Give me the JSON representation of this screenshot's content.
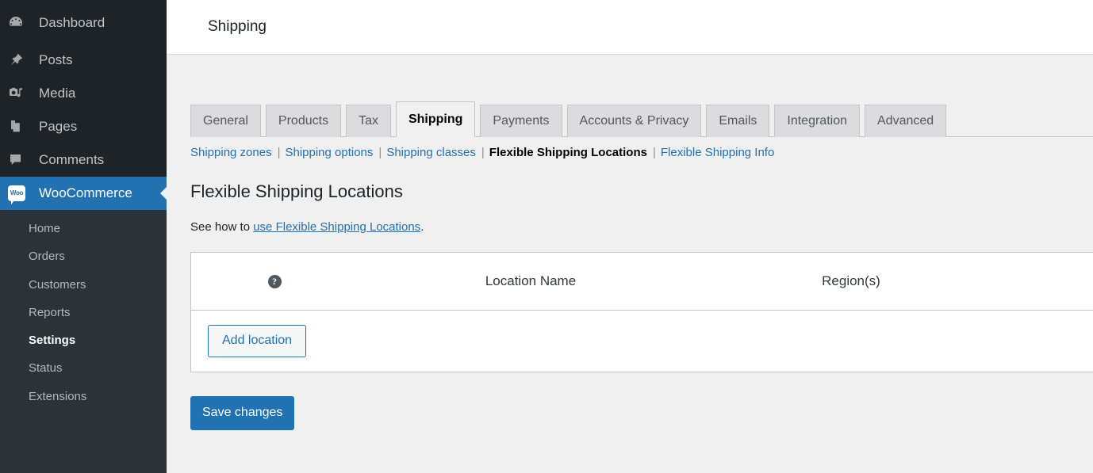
{
  "header": {
    "title": "Shipping"
  },
  "sidebar": {
    "items": [
      {
        "label": "Dashboard",
        "icon": "dashboard-icon"
      },
      {
        "label": "Posts",
        "icon": "pin-icon"
      },
      {
        "label": "Media",
        "icon": "media-icon"
      },
      {
        "label": "Pages",
        "icon": "pages-icon"
      },
      {
        "label": "Comments",
        "icon": "comment-icon"
      },
      {
        "label": "WooCommerce",
        "icon": "woocommerce-logo",
        "active": true
      }
    ],
    "woo_logo_text": "Woo",
    "submenu": [
      {
        "label": "Home"
      },
      {
        "label": "Orders"
      },
      {
        "label": "Customers"
      },
      {
        "label": "Reports"
      },
      {
        "label": "Settings",
        "current": true
      },
      {
        "label": "Status"
      },
      {
        "label": "Extensions"
      }
    ]
  },
  "tabs": [
    {
      "label": "General"
    },
    {
      "label": "Products"
    },
    {
      "label": "Tax"
    },
    {
      "label": "Shipping",
      "active": true
    },
    {
      "label": "Payments"
    },
    {
      "label": "Accounts & Privacy"
    },
    {
      "label": "Emails"
    },
    {
      "label": "Integration"
    },
    {
      "label": "Advanced"
    }
  ],
  "subnav": {
    "separator": "|",
    "links": [
      {
        "label": "Shipping zones"
      },
      {
        "label": "Shipping options"
      },
      {
        "label": "Shipping classes"
      },
      {
        "label": "Flexible Shipping Locations",
        "current": true
      },
      {
        "label": "Flexible Shipping Info"
      }
    ]
  },
  "page": {
    "title": "Flexible Shipping Locations",
    "description_prefix": "See how to ",
    "description_link": "use Flexible Shipping Locations",
    "description_suffix": "."
  },
  "table": {
    "help_glyph": "?",
    "columns": [
      {
        "label": "Location Name"
      },
      {
        "label": "Region(s)"
      }
    ],
    "rows": [],
    "add_button": "Add location"
  },
  "actions": {
    "save": "Save changes"
  },
  "colors": {
    "accent": "#2271b1",
    "sidebar_bg": "#1d2327",
    "submenu_bg": "#2c3338",
    "page_bg": "#f0f0f1",
    "tab_bg": "#dcdcde",
    "border": "#c3c4c7"
  }
}
